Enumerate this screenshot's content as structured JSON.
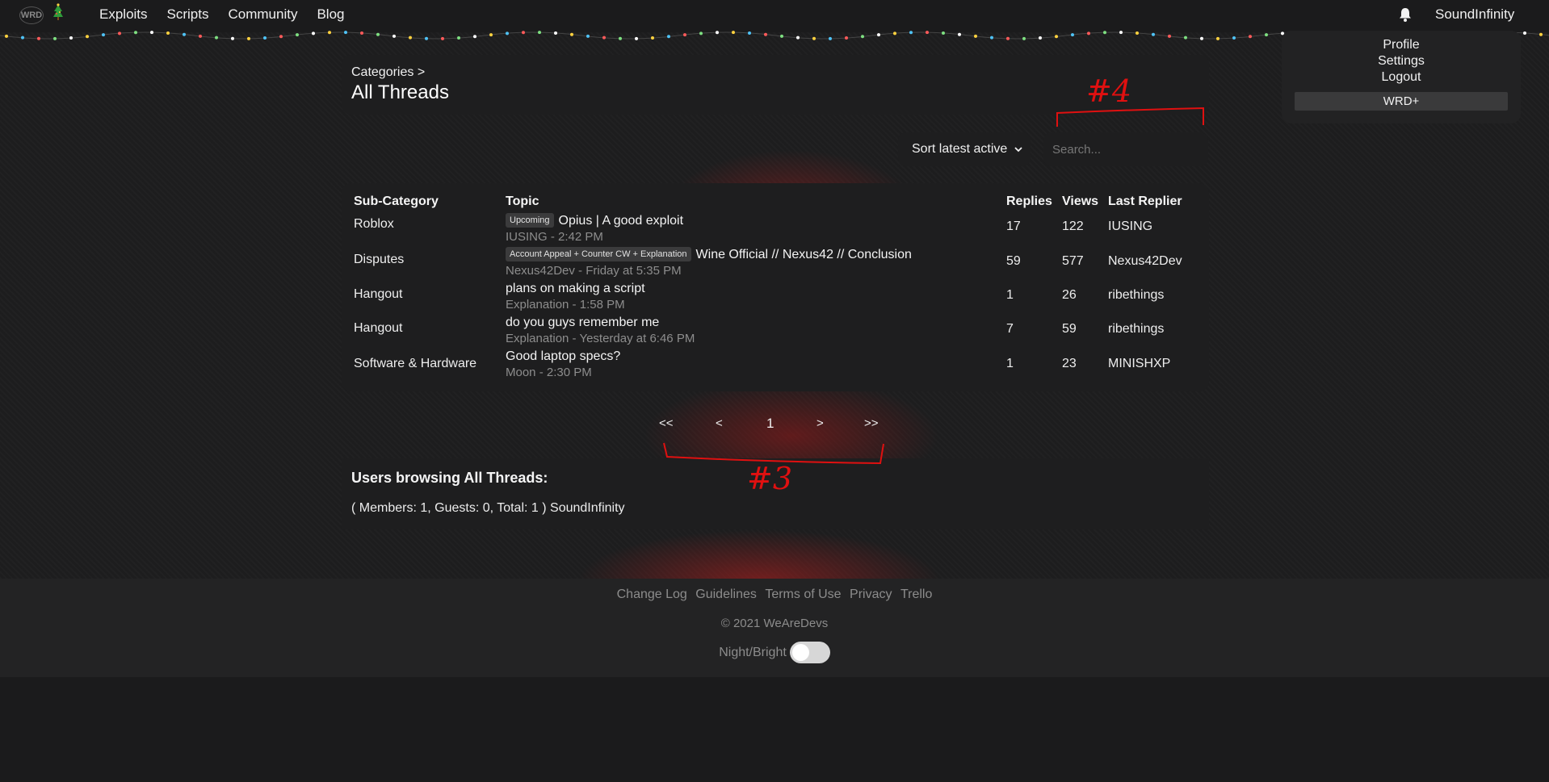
{
  "brand": {
    "logo_text": "WRD"
  },
  "nav": {
    "links": [
      "Exploits",
      "Scripts",
      "Community",
      "Blog"
    ],
    "username": "SoundInfinity"
  },
  "user_menu": {
    "items": [
      "Profile",
      "Settings",
      "Logout"
    ],
    "plus_label": "WRD+"
  },
  "header": {
    "breadcrumb": "Categories >",
    "title": "All Threads"
  },
  "controls": {
    "sort_label": "Sort latest active",
    "search_placeholder": "Search..."
  },
  "table": {
    "headers": [
      "Sub-Category",
      "Topic",
      "Replies",
      "Views",
      "Last Replier"
    ],
    "rows": [
      {
        "subcategory": "Roblox",
        "badge": "Upcoming",
        "title": "Opius | A good exploit",
        "meta": "IUSING - 2:42 PM",
        "replies": "17",
        "views": "122",
        "last_replier": "IUSING"
      },
      {
        "subcategory": "Disputes",
        "badge": "Account Appeal + Counter CW + Explanation",
        "title": "Wine Official // Nexus42 // Conclusion",
        "meta": "Nexus42Dev - Friday at 5:35 PM",
        "replies": "59",
        "views": "577",
        "last_replier": "Nexus42Dev"
      },
      {
        "subcategory": "Hangout",
        "badge": "",
        "title": "plans on making a script",
        "meta": "Explanation - 1:58 PM",
        "replies": "1",
        "views": "26",
        "last_replier": "ribethings"
      },
      {
        "subcategory": "Hangout",
        "badge": "",
        "title": "do you guys remember me",
        "meta": "Explanation - Yesterday at 6:46 PM",
        "replies": "7",
        "views": "59",
        "last_replier": "ribethings"
      },
      {
        "subcategory": "Software & Hardware",
        "badge": "",
        "title": "Good laptop specs?",
        "meta": "Moon - 2:30 PM",
        "replies": "1",
        "views": "23",
        "last_replier": "MINISHXP"
      }
    ]
  },
  "pagination": {
    "first": "<<",
    "prev": "<",
    "current": "1",
    "next": ">",
    "last": ">>"
  },
  "browsing": {
    "title": "Users browsing All Threads:",
    "stats": "( Members: 1, Guests: 0, Total: 1 ) SoundInfinity"
  },
  "footer": {
    "links": [
      "Change Log",
      "Guidelines",
      "Terms of Use",
      "Privacy",
      "Trello"
    ],
    "copyright": "© 2021 WeAreDevs",
    "theme_label": "Night/Bright"
  },
  "annotations": {
    "label_search": "#4",
    "label_pagination": "#3",
    "color": "#e01010"
  },
  "colors": {
    "background": "#1b1b1c",
    "card": "#1e1e1f",
    "muted_text": "#8d8d8d",
    "accent_red": "#b01e1e"
  }
}
